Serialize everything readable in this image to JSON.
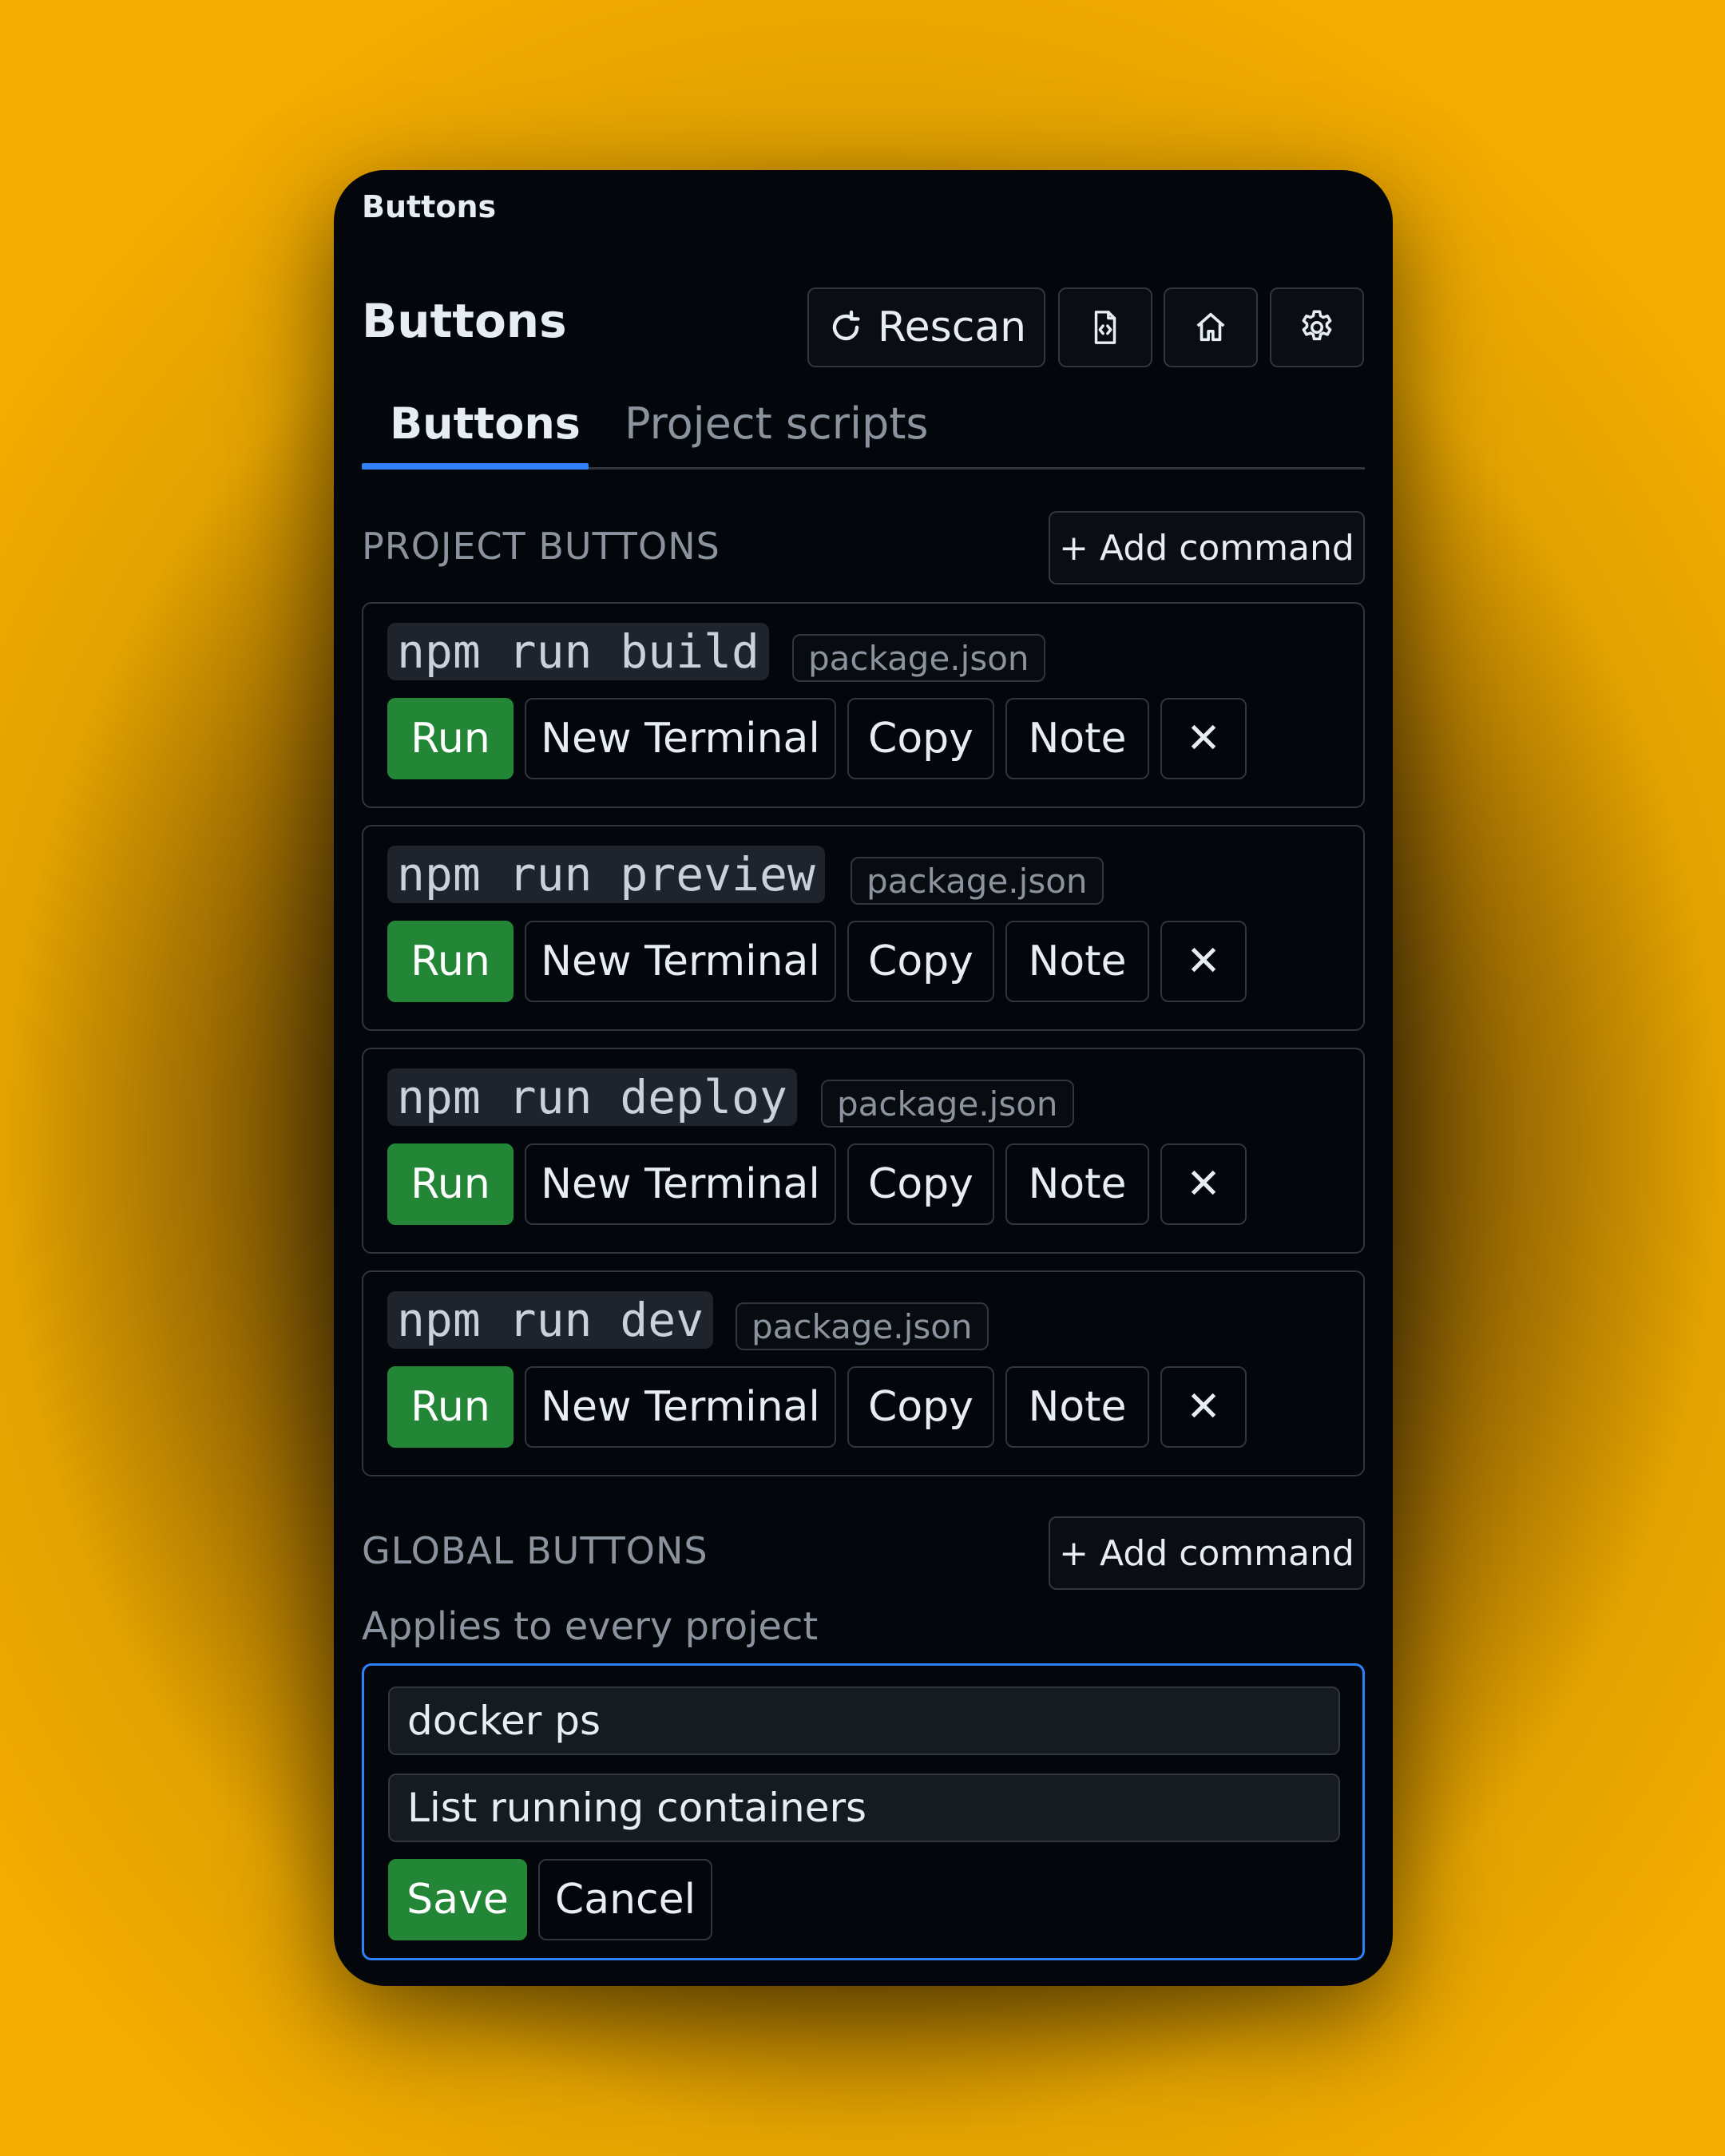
{
  "window": {
    "panel_label": "Buttons",
    "title": "Buttons"
  },
  "toolbar": {
    "rescan_label": "Rescan",
    "icons": [
      "refresh-icon",
      "file-code-icon",
      "home-icon",
      "gear-icon"
    ]
  },
  "tabs": [
    {
      "label": "Buttons",
      "active": true
    },
    {
      "label": "Project scripts",
      "active": false
    }
  ],
  "project": {
    "section_title": "PROJECT BUTTONS",
    "add_label": "+ Add command",
    "commands": [
      {
        "command": "npm run build",
        "source": "package.json"
      },
      {
        "command": "npm run preview",
        "source": "package.json"
      },
      {
        "command": "npm run deploy",
        "source": "package.json"
      },
      {
        "command": "npm run dev",
        "source": "package.json"
      }
    ]
  },
  "actions": {
    "run": "Run",
    "new_terminal": "New Terminal",
    "copy": "Copy",
    "note": "Note",
    "remove": "✕"
  },
  "global": {
    "section_title": "GLOBAL BUTTONS",
    "add_label": "+ Add command",
    "description": "Applies to every project",
    "form": {
      "command_value": "docker ps",
      "note_value": "List running containers",
      "save_label": "Save",
      "cancel_label": "Cancel"
    }
  },
  "colors": {
    "background_outer": "#f5ac00",
    "panel": "#03060b",
    "accent_blue": "#2f81f7",
    "run_green": "#238636",
    "border": "#30363d",
    "muted_text": "#8b949e"
  }
}
